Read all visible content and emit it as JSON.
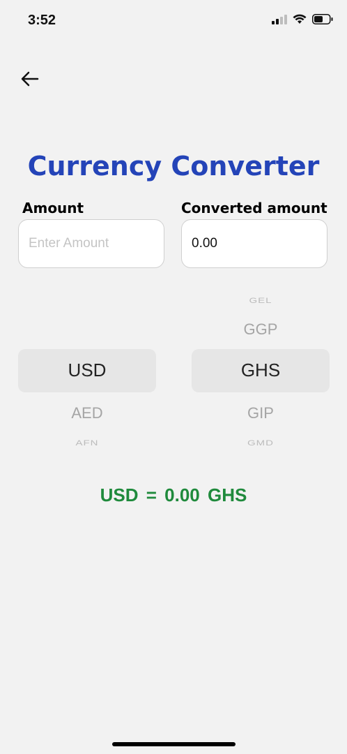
{
  "status_bar": {
    "time": "3:52",
    "icons": [
      "cellular-signal-icon",
      "wifi-icon",
      "battery-icon"
    ]
  },
  "header": {
    "back_icon": "arrow-left-icon",
    "title": "Currency Converter"
  },
  "amount": {
    "label": "Amount",
    "value": "",
    "placeholder": "Enter Amount"
  },
  "converted": {
    "label": "Converted amount",
    "value": "0.00"
  },
  "from_picker": {
    "prev2": "",
    "prev1": "",
    "selected": "USD",
    "next1": "AED",
    "next2": "AFN"
  },
  "to_picker": {
    "prev2": "GEL",
    "prev1": "GGP",
    "selected": "GHS",
    "next1": "GIP",
    "next2": "GMD"
  },
  "result": {
    "text": "USD = 0.00 GHS"
  },
  "colors": {
    "background": "#f2f2f2",
    "title": "#2444b8",
    "result": "#1f8a3c",
    "picker_highlight": "#e6e6e6"
  }
}
